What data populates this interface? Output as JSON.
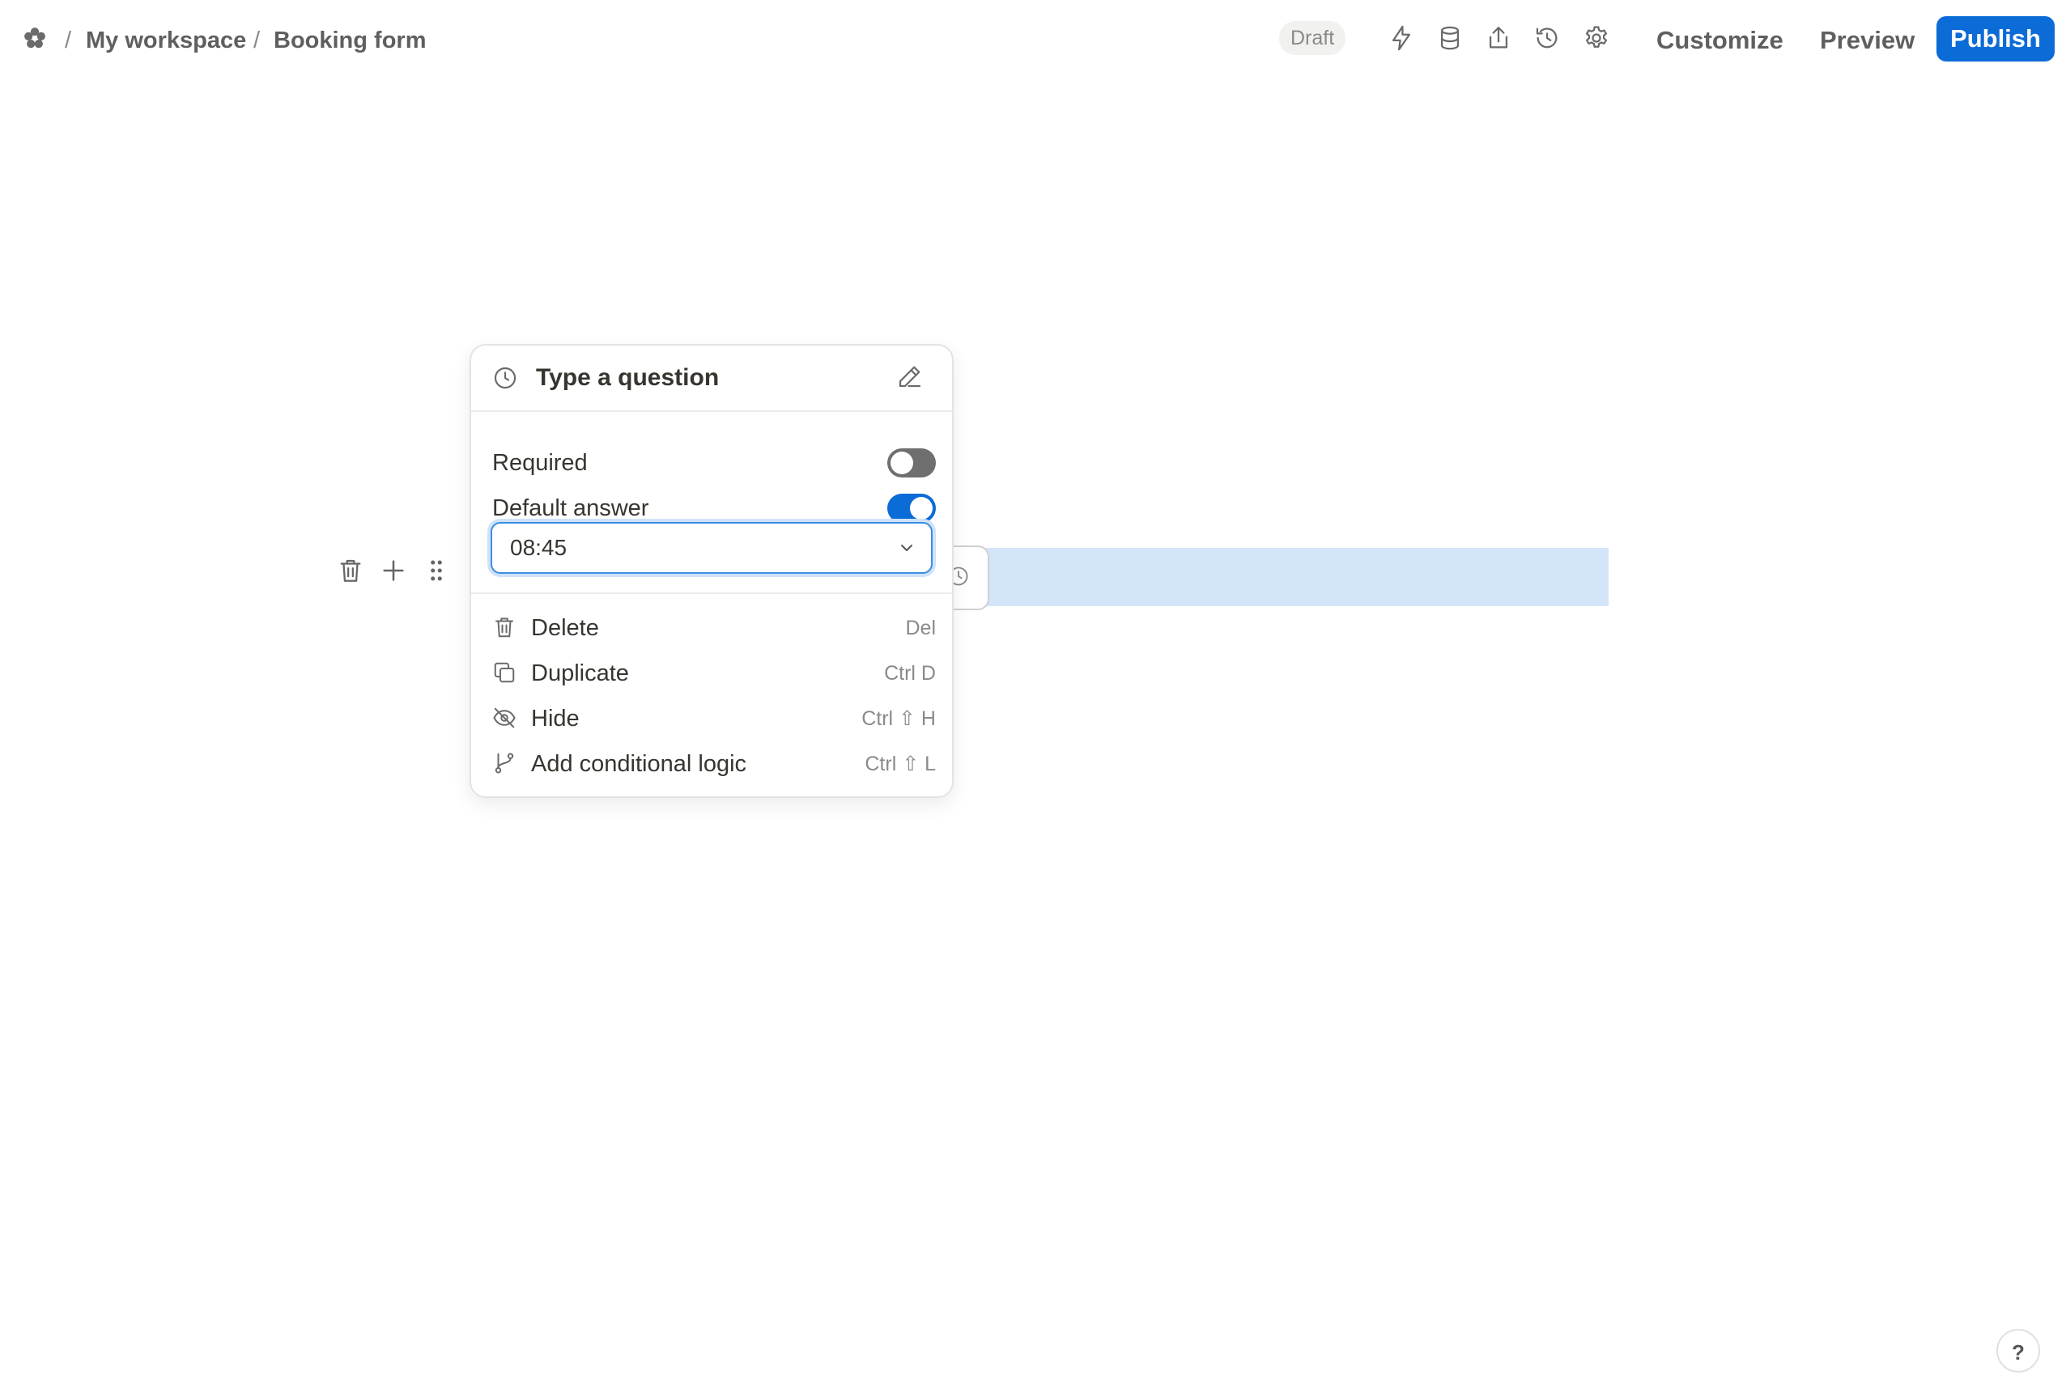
{
  "breadcrumb": {
    "logo_icon": "flower-logo-icon",
    "separator": "/",
    "workspace": "My workspace",
    "page": "Booking form"
  },
  "header": {
    "status_badge": "Draft",
    "icons": [
      "lightning-icon",
      "database-icon",
      "share-icon",
      "history-icon",
      "settings-gear-icon"
    ],
    "customize_label": "Customize",
    "preview_label": "Preview",
    "publish_label": "Publish",
    "accent_color": "#0b6bd7"
  },
  "block_tools": {
    "icons": [
      "trash-icon",
      "plus-icon",
      "drag-handle-icon"
    ]
  },
  "popover": {
    "question_icon": "clock-icon",
    "question_placeholder": "Type a question",
    "required": {
      "label": "Required",
      "enabled": false
    },
    "default_answer": {
      "label": "Default answer",
      "enabled": true
    },
    "time_value": "08:45",
    "menu": [
      {
        "label": "Delete",
        "shortcut": "Del",
        "icon": "trash-icon"
      },
      {
        "label": "Duplicate",
        "shortcut": "Ctrl D",
        "icon": "duplicate-icon"
      },
      {
        "label": "Hide",
        "shortcut": "Ctrl ⇧ H",
        "icon": "eye-off-icon"
      },
      {
        "label": "Add conditional logic",
        "shortcut": "Ctrl ⇧ L",
        "icon": "branch-icon"
      }
    ]
  },
  "help": {
    "label": "?"
  }
}
